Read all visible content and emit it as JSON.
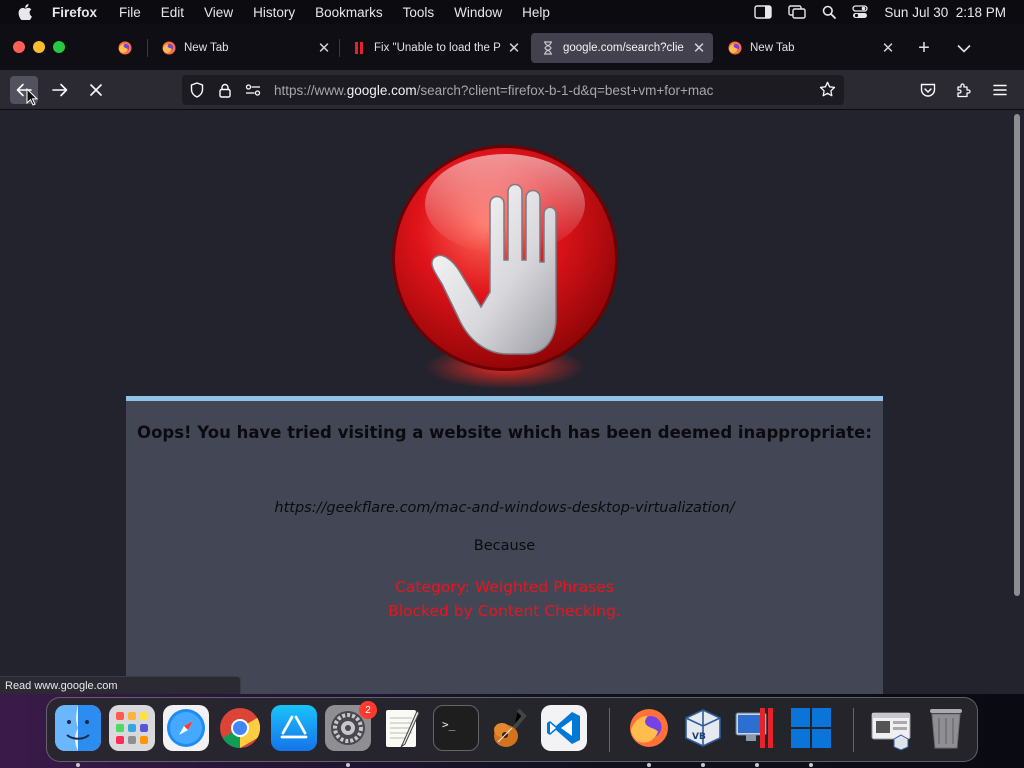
{
  "menubar": {
    "app_name": "Firefox",
    "items": [
      "File",
      "Edit",
      "View",
      "History",
      "Bookmarks",
      "Tools",
      "Window",
      "Help"
    ],
    "datetime": "Sun Jul 30  2:18 PM"
  },
  "tabs": [
    {
      "title": "New Tab",
      "icon": "firefox-icon",
      "active": false
    },
    {
      "title": "Fix \"Unable to load the P",
      "icon": "parallels-icon",
      "active": false
    },
    {
      "title": "google.com/search?clie",
      "icon": "loading-hourglass-icon",
      "active": true
    },
    {
      "title": "New Tab",
      "icon": "firefox-icon",
      "active": false
    }
  ],
  "navbar": {
    "url_prefix": "https://www.",
    "url_domain": "google.com",
    "url_suffix": "/search?client=firefox-b-1-d&q=best+vm+for+mac"
  },
  "block_page": {
    "headline": "Oops! You have tried visiting a website which has been deemed inappropriate:",
    "blocked_url": "https://geekflare.com/mac-and-windows-desktop-virtualization/",
    "because": "Because",
    "category": "Category: Weighted Phrases",
    "reason": "Blocked by Content Checking.",
    "reason_color": "#e8151f",
    "panel_color": "#434755",
    "accent_color": "#8fc4e6"
  },
  "status_bar": {
    "text": "Read www.google.com"
  },
  "dock": {
    "items": [
      {
        "name": "Finder",
        "icon": "finder-icon",
        "running": true
      },
      {
        "name": "Launchpad",
        "icon": "launchpad-icon",
        "running": false
      },
      {
        "name": "Safari",
        "icon": "safari-icon",
        "running": false
      },
      {
        "name": "Google Chrome",
        "icon": "chrome-icon",
        "running": false
      },
      {
        "name": "App Store",
        "icon": "app-store-icon",
        "running": false
      },
      {
        "name": "System Settings",
        "icon": "system-settings-icon",
        "running": true,
        "badge": "2"
      },
      {
        "name": "TextEdit",
        "icon": "textedit-icon",
        "running": false
      },
      {
        "name": "Terminal",
        "icon": "terminal-icon",
        "running": false
      },
      {
        "name": "GarageBand",
        "icon": "garageband-icon",
        "running": false
      },
      {
        "name": "Visual Studio Code",
        "icon": "vscode-icon",
        "running": false
      },
      {
        "name": "Firefox",
        "icon": "firefox-icon",
        "running": true
      },
      {
        "name": "VirtualBox",
        "icon": "virtualbox-icon",
        "running": true
      },
      {
        "name": "Parallels Desktop",
        "icon": "parallels-desktop-icon",
        "running": true
      },
      {
        "name": "Windows",
        "icon": "windows-icon",
        "running": true
      },
      {
        "name": "Downloads",
        "icon": "downloads-stack-icon",
        "running": false
      },
      {
        "name": "Trash",
        "icon": "trash-icon",
        "running": false
      }
    ]
  }
}
